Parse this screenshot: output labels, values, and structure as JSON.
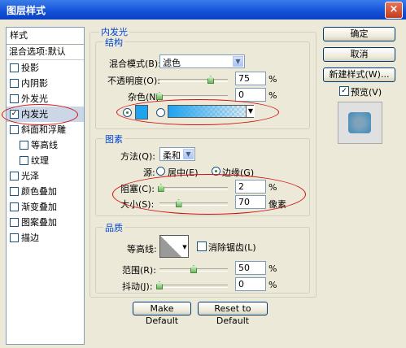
{
  "window": {
    "title": "图层样式",
    "close": "×"
  },
  "sidebar": {
    "header": "样式",
    "blend_options": "混合选项:默认",
    "items": [
      {
        "label": "投影",
        "checked": false,
        "sub": false
      },
      {
        "label": "内阴影",
        "checked": false,
        "sub": false
      },
      {
        "label": "外发光",
        "checked": false,
        "sub": false
      },
      {
        "label": "内发光",
        "checked": true,
        "sub": false,
        "selected": true
      },
      {
        "label": "斜面和浮雕",
        "checked": false,
        "sub": false
      },
      {
        "label": "等高线",
        "checked": false,
        "sub": true
      },
      {
        "label": "纹理",
        "checked": false,
        "sub": true
      },
      {
        "label": "光泽",
        "checked": false,
        "sub": false
      },
      {
        "label": "颜色叠加",
        "checked": false,
        "sub": false
      },
      {
        "label": "渐变叠加",
        "checked": false,
        "sub": false
      },
      {
        "label": "图案叠加",
        "checked": false,
        "sub": false
      },
      {
        "label": "描边",
        "checked": false,
        "sub": false
      }
    ]
  },
  "panel": {
    "section_title": "内发光",
    "structure": {
      "title": "结构",
      "blend_mode_label": "混合模式(B):",
      "blend_mode_value": "滤色",
      "opacity_label": "不透明度(O):",
      "opacity_value": "75",
      "opacity_unit": "%",
      "opacity_level": 75,
      "noise_label": "杂色(N):",
      "noise_value": "0",
      "noise_unit": "%",
      "noise_level": 0,
      "color_swatch": "#1fa3ee"
    },
    "elements": {
      "title": "图素",
      "method_label": "方法(Q):",
      "method_value": "柔和",
      "source_label": "源:",
      "source_center": "居中(E)",
      "source_edge": "边缘(G)",
      "choke_label": "阻塞(C):",
      "choke_value": "2",
      "choke_unit": "%",
      "choke_level": 2,
      "size_label": "大小(S):",
      "size_value": "70",
      "size_unit": "像素",
      "size_level": 28
    },
    "quality": {
      "title": "品质",
      "contour_label": "等高线:",
      "antialias_label": "消除锯齿(L)",
      "range_label": "范围(R):",
      "range_value": "50",
      "range_unit": "%",
      "range_level": 50,
      "jitter_label": "抖动(J):",
      "jitter_value": "0",
      "jitter_unit": "%",
      "jitter_level": 0
    },
    "make_default": "Make Default",
    "reset_default": "Reset to Default"
  },
  "right": {
    "ok": "确定",
    "cancel": "取消",
    "new_style": "新建样式(W)...",
    "preview_label": "预览(V)",
    "preview_checked": true
  }
}
